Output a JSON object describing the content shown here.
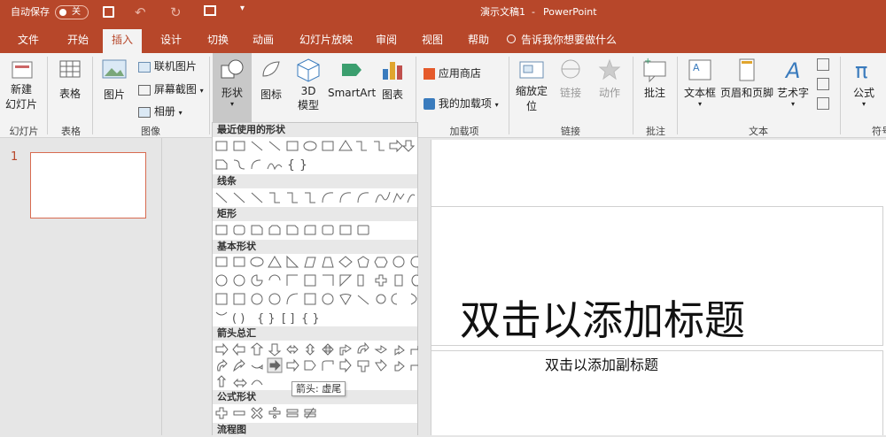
{
  "titlebar": {
    "autosave_label": "自动保存",
    "toggle_label": "关",
    "document_title": "演示文稿1",
    "app_name": "PowerPoint"
  },
  "tabs": [
    "文件",
    "开始",
    "插入",
    "设计",
    "切换",
    "动画",
    "幻灯片放映",
    "审阅",
    "视图",
    "帮助"
  ],
  "tell_me": "告诉我你想要做什么",
  "ribbon": {
    "new_slide": "新建\n幻灯片",
    "new_slide_lines": [
      "新建",
      "幻灯片"
    ],
    "table": "表格",
    "picture": "图片",
    "online_picture": "联机图片",
    "screenshot": "屏幕截图",
    "album": "相册",
    "shapes": "形状",
    "icons": "图标",
    "model_3d": "3D\n模型",
    "model_3d_lines": [
      "3D",
      "模型"
    ],
    "smartart": "SmartArt",
    "chart": "图表",
    "store": "应用商店",
    "my_addins": "我的加载项",
    "zoom_lines": [
      "缩放定",
      "位"
    ],
    "link": "链接",
    "action": "动作",
    "comment": "批注",
    "textbox": "文本框",
    "header_footer": "页眉和页脚",
    "wordart": "艺术字",
    "equation": "公式",
    "groups": [
      "幻灯片",
      "表格",
      "图像",
      "加载项",
      "链接",
      "批注",
      "文本",
      "符号"
    ]
  },
  "slide_panel": {
    "number": "1"
  },
  "dropdown": {
    "sections": [
      "最近使用的形状",
      "线条",
      "矩形",
      "基本形状",
      "箭头总汇",
      "公式形状",
      "流程图"
    ],
    "tooltip": "箭头: 虚尾"
  },
  "slide": {
    "title_placeholder": "双击以添加标题",
    "subtitle_placeholder": "双击以添加副标题"
  },
  "colors": {
    "accent": "#b7472a",
    "ribbon_bg": "#f3f3f3"
  }
}
